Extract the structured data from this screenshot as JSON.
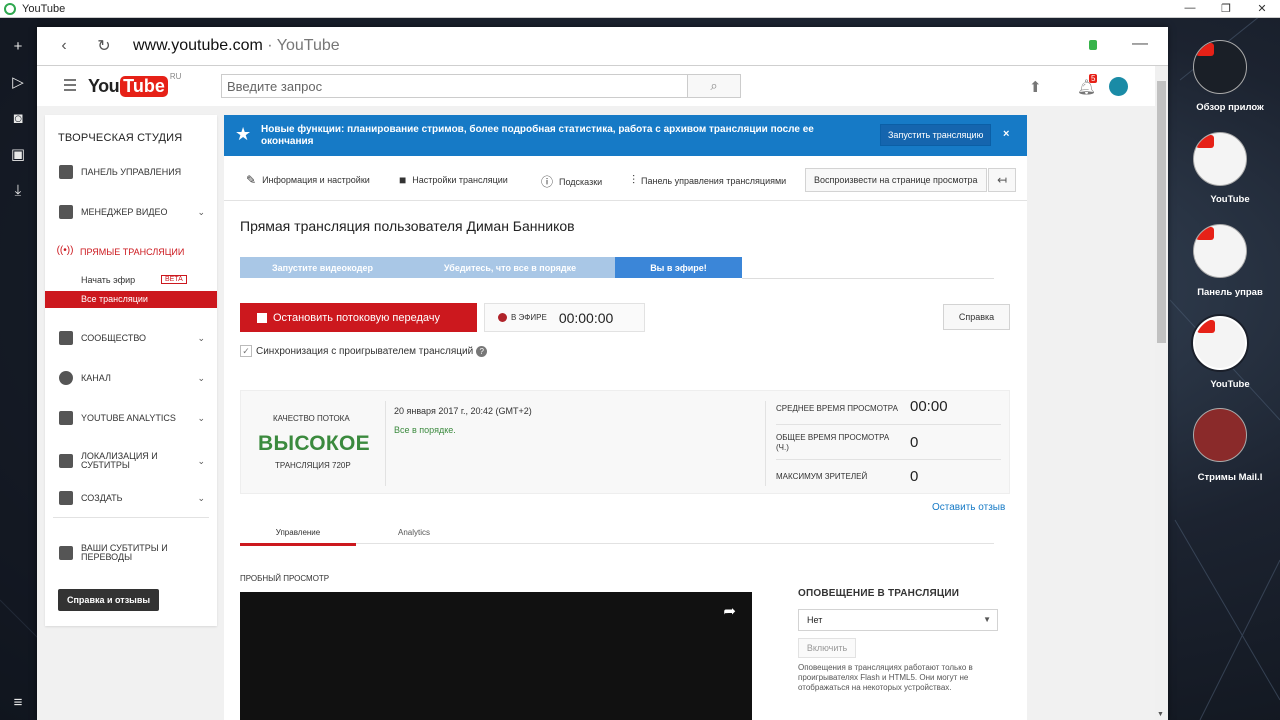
{
  "window": {
    "title": "YouTube",
    "controls": [
      "—",
      "❐",
      "✕"
    ]
  },
  "browser": {
    "url_domain": "www.youtube.com",
    "url_sep": " · ",
    "url_title": "YouTube"
  },
  "yt_header": {
    "logo_you": "You",
    "logo_tube": "Tube",
    "logo_region": "RU",
    "search_placeholder": "Введите запрос",
    "notification_count": "5"
  },
  "leftnav": {
    "studio_title": "ТВОРЧЕСКАЯ СТУДИЯ",
    "items": [
      {
        "label": "ПАНЕЛЬ УПРАВЛЕНИЯ"
      },
      {
        "label": "МЕНЕДЖЕР ВИДЕО"
      },
      {
        "label": "ПРЯМЫЕ ТРАНСЛЯЦИИ"
      },
      {
        "label": "СООБЩЕСТВО"
      },
      {
        "label": "КАНАЛ"
      },
      {
        "label": "YOUTUBE ANALYTICS"
      },
      {
        "label": "ЛОКАЛИЗАЦИЯ И СУБТИТРЫ"
      },
      {
        "label": "СОЗДАТЬ"
      },
      {
        "label": "ВАШИ СУБТИТРЫ И ПЕРЕВОДЫ"
      }
    ],
    "sub_start": "Начать эфир",
    "beta": "BETA",
    "sub_all": "Все трансляции",
    "help_button": "Справка и отзывы"
  },
  "banner": {
    "text": "Новые функции: планирование стримов, более подробная статистика, работа с архивом трансляции после ее окончания",
    "button": "Запустить трансляцию",
    "close": "×"
  },
  "tabs": {
    "info": "Информация и настройки",
    "stream_settings": "Настройки трансляции",
    "tips": "Подсказки",
    "control_panel": "Панель управления трансляциями",
    "play_on_page": "Воспроизвести на странице просмотра"
  },
  "stream": {
    "title": "Прямая трансляция пользователя Диман Банников",
    "steps": [
      "Запустите видеокодер",
      "Убедитесь, что все в порядке",
      "Вы в эфире!"
    ],
    "stop_button": "Остановить потоковую передачу",
    "on_air_label": "В ЭФИРЕ",
    "timer": "00:00:00",
    "help_button": "Справка",
    "sync_label": "Синхронизация с проигрывателем трансляций"
  },
  "stats": {
    "quality_label": "КАЧЕСТВО ПОТОКА",
    "quality_value": "ВЫСОКОЕ",
    "quality_sub": "ТРАНСЛЯЦИЯ 720P",
    "date": "20 января 2017 г., 20:42 (GMT+2)",
    "status": "Все в порядке.",
    "avg_watch_label": "СРЕДНЕЕ ВРЕМЯ ПРОСМОТРА",
    "avg_watch_value": "00:00",
    "total_watch_label": "ОБЩЕЕ ВРЕМЯ ПРОСМОТРА (Ч.)",
    "total_watch_value": "0",
    "max_viewers_label": "МАКСИМУМ ЗРИТЕЛЕЙ",
    "max_viewers_value": "0",
    "feedback_link": "Оставить отзыв"
  },
  "subtabs": {
    "manage": "Управление",
    "analytics": "Analytics"
  },
  "preview": {
    "label": "ПРОБНЫЙ ПРОСМОТР"
  },
  "notifications": {
    "title": "ОПОВЕЩЕНИЕ В ТРАНСЛЯЦИИ",
    "select_value": "Нет",
    "enable_button": "Включить",
    "note": "Оповещения в трансляциях работают только в проигрывателях Flash и HTML5. Они могут не отображаться на некоторых устройствах."
  },
  "right_panel": {
    "tiles": [
      {
        "label": "Обзор прилож"
      },
      {
        "label": "YouTube"
      },
      {
        "label": "Панель управ"
      },
      {
        "label": "YouTube"
      },
      {
        "label": "Стримы Mail.I"
      }
    ]
  },
  "colors": {
    "accent_red": "#cc181e",
    "banner_blue": "#167ac6",
    "quality_green": "#3b8a3e"
  }
}
